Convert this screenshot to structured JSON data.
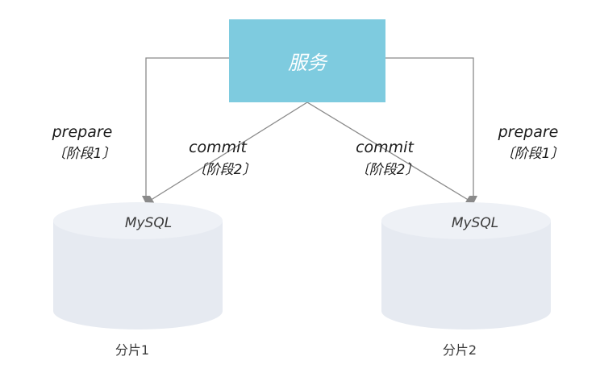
{
  "service": {
    "label": "服务",
    "fill_color": "#7ecbdf"
  },
  "databases": [
    {
      "engine": "MySQL",
      "shard_label": "分片1"
    },
    {
      "engine": "MySQL",
      "shard_label": "分片2"
    }
  ],
  "edges": {
    "prepare_left": {
      "line1": "prepare",
      "line2": "〔阶段1〕"
    },
    "prepare_right": {
      "line1": "prepare",
      "line2": "〔阶段1〕"
    },
    "commit_left": {
      "line1": "commit",
      "line2": "〔阶段2〕"
    },
    "commit_right": {
      "line1": "commit",
      "line2": "〔阶段2〕"
    }
  },
  "colors": {
    "line": "#8a8a8a",
    "database_fill": "#e6eaf1",
    "database_top": "#eef1f6"
  }
}
